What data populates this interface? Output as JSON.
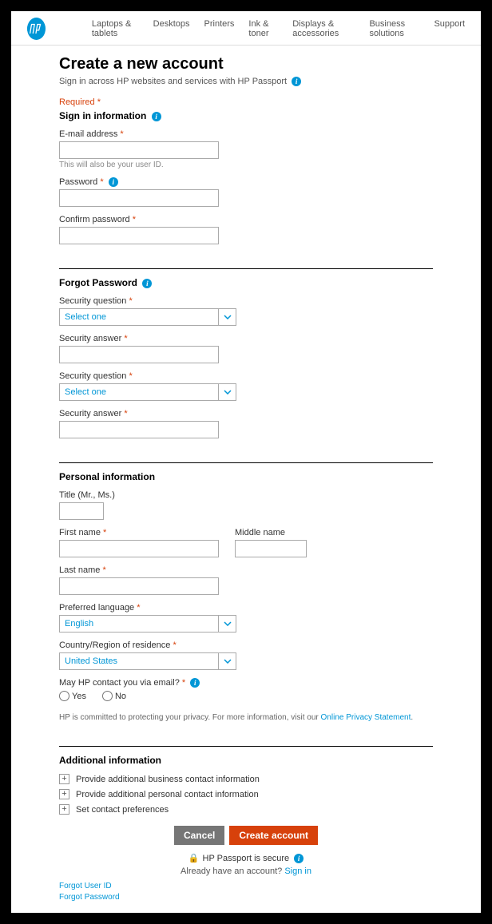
{
  "nav": {
    "items": [
      "Laptops & tablets",
      "Desktops",
      "Printers",
      "Ink & toner",
      "Displays & accessories",
      "Business solutions",
      "Support"
    ]
  },
  "title": "Create a new account",
  "subtitle": "Sign in across HP websites and services with HP Passport",
  "required_note": "Required *",
  "sections": {
    "signin": {
      "heading": "Sign in information",
      "email_label": "E-mail address",
      "email_hint": "This will also be your user ID.",
      "password_label": "Password",
      "confirm_label": "Confirm password"
    },
    "forgot": {
      "heading": "Forgot Password",
      "sq1_label": "Security question",
      "sq1_value": "Select one",
      "sa1_label": "Security answer",
      "sq2_label": "Security question",
      "sq2_value": "Select one",
      "sa2_label": "Security answer"
    },
    "personal": {
      "heading": "Personal information",
      "title_label": "Title (Mr., Ms.)",
      "first_label": "First name",
      "middle_label": "Middle name",
      "last_label": "Last name",
      "lang_label": "Preferred language",
      "lang_value": "English",
      "country_label": "Country/Region of residence",
      "country_value": "United States",
      "contact_label": "May HP contact you via email?",
      "yes_label": "Yes",
      "no_label": "No",
      "privacy_text": "HP is committed to protecting your privacy. For more information, visit our ",
      "privacy_link": "Online Privacy Statement"
    },
    "additional": {
      "heading": "Additional information",
      "items": [
        "Provide additional business contact information",
        "Provide additional personal contact information",
        "Set contact preferences"
      ]
    }
  },
  "buttons": {
    "cancel": "Cancel",
    "create": "Create account"
  },
  "secure_text": "HP Passport is secure",
  "signin_prompt": "Already have an account? ",
  "signin_link": "Sign in",
  "footer": {
    "link1": "Forgot User ID",
    "link2": "Forgot Password"
  }
}
